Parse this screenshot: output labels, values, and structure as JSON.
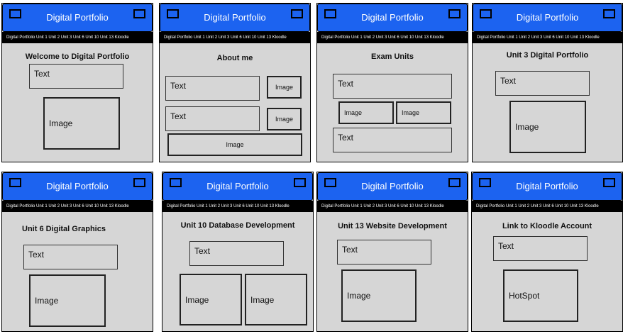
{
  "header": {
    "title": "Digital Portfolio"
  },
  "nav": {
    "label": "Digital Portfolio Unit 1 Unit 2 Unit 3 Unit 6 Unit 10 Unit 13 Kloodle"
  },
  "pages": [
    {
      "title": "Welcome to Digital Portfolio",
      "boxes": [
        "Text",
        "Image"
      ]
    },
    {
      "title": "About me",
      "boxes": [
        "Text",
        "Image",
        "Text",
        "Image",
        "Image"
      ]
    },
    {
      "title": "Exam Units",
      "boxes": [
        "Text",
        "Image",
        "Image",
        "Text"
      ]
    },
    {
      "title": "Unit 3 Digital Portfolio",
      "boxes": [
        "Text",
        "Image"
      ]
    },
    {
      "title": "Unit 6 Digital Graphics",
      "boxes": [
        "Text",
        "Image"
      ]
    },
    {
      "title": "Unit 10 Database Development",
      "boxes": [
        "Text",
        "Image",
        "Image"
      ]
    },
    {
      "title": "Unit 13 Website Development",
      "boxes": [
        "Text",
        "Image"
      ]
    },
    {
      "title": "Link to Kloodle Account",
      "boxes": [
        "Text",
        "HotSpot"
      ]
    }
  ]
}
